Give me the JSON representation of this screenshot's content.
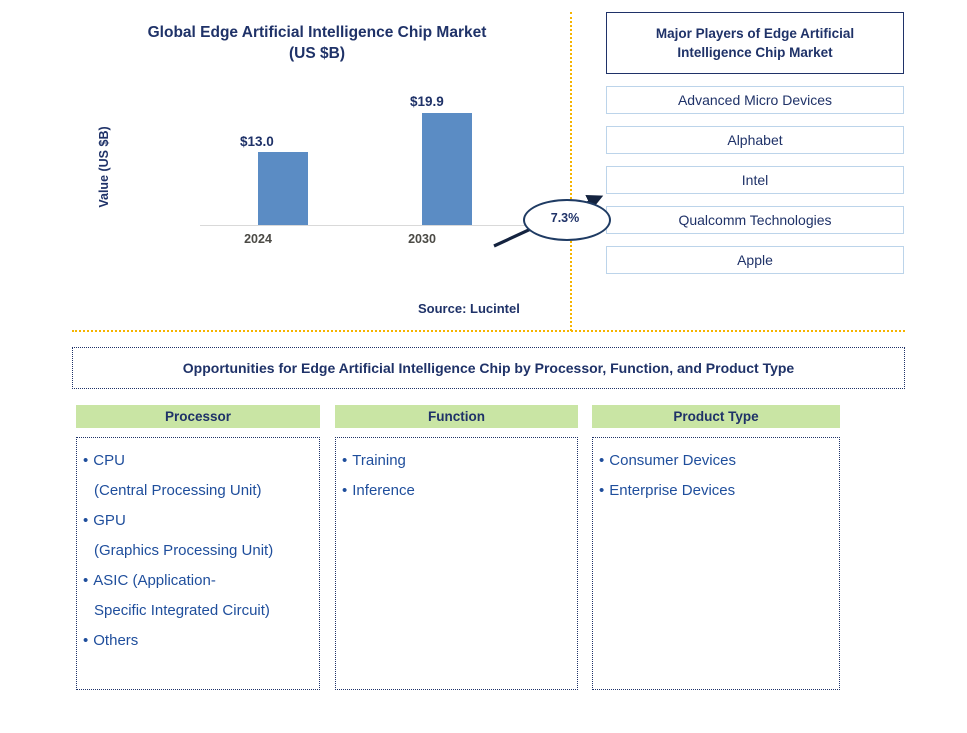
{
  "chart_panel": {
    "title_line1": "Global Edge Artificial Intelligence Chip  Market",
    "title_line2": "(US $B)",
    "y_axis_label": "Value (US $B)"
  },
  "chart_data": {
    "type": "bar",
    "title": "Global Edge Artificial Intelligence Chip  Market (US $B)",
    "xlabel": "",
    "ylabel": "Value (US $B)",
    "categories": [
      "2024",
      "2030"
    ],
    "values": [
      13.0,
      19.9
    ],
    "value_labels": [
      "$13.0",
      "$19.9"
    ],
    "ylim": [
      0,
      22
    ],
    "grid": false,
    "legend": "none",
    "bar_color": "#5b8cc4",
    "annotations": [
      {
        "type": "cagr-ellipse",
        "label": "7.3%",
        "from": "2024",
        "to": "2030"
      }
    ]
  },
  "players": {
    "header": "Major Players of Edge Artificial Intelligence Chip  Market",
    "items": [
      "Advanced Micro Devices",
      "Alphabet",
      "Intel",
      "Qualcomm Technologies",
      "Apple"
    ]
  },
  "source": "Source: Lucintel",
  "opportunities": {
    "banner": "Opportunities for Edge Artificial Intelligence Chip  by Processor, Function, and Product Type",
    "columns": [
      {
        "header": "Processor",
        "items": [
          {
            "text": "CPU",
            "continuation": "(Central Processing Unit)"
          },
          {
            "text": "GPU",
            "continuation": "(Graphics Processing Unit)"
          },
          {
            "text": "ASIC (Application-",
            "continuation": "Specific Integrated Circuit)"
          },
          {
            "text": "Others",
            "continuation": ""
          }
        ]
      },
      {
        "header": "Function",
        "items": [
          {
            "text": "Training",
            "continuation": ""
          },
          {
            "text": "Inference",
            "continuation": ""
          }
        ]
      },
      {
        "header": "Product Type",
        "items": [
          {
            "text": "Consumer Devices",
            "continuation": ""
          },
          {
            "text": "Enterprise Devices",
            "continuation": ""
          }
        ]
      }
    ]
  },
  "colors": {
    "navy": "#1f3268",
    "bar_blue": "#5b8cc4",
    "divider_amber": "#f5b400",
    "header_green": "#c9e5a4",
    "list_border_blue": "#bcd4ea"
  }
}
